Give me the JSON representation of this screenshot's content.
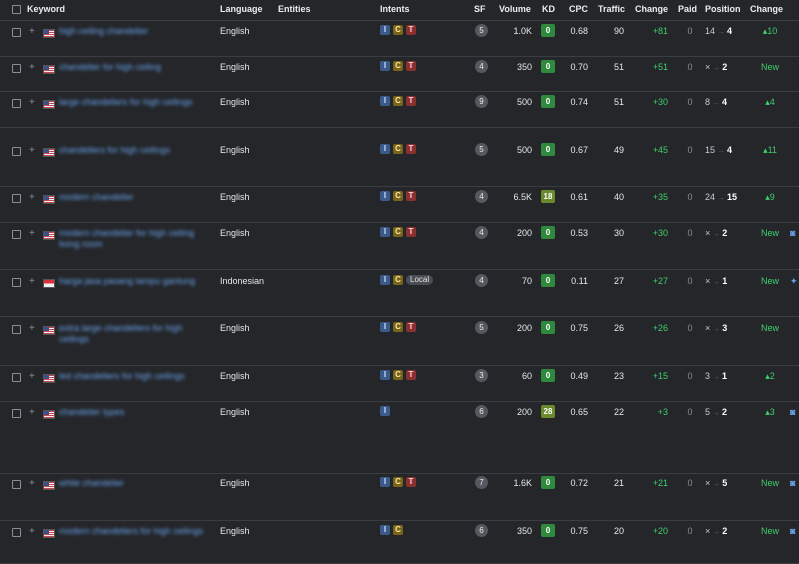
{
  "header": {
    "keyword": "Keyword",
    "language": "Language",
    "entities": "Entities",
    "intents": "Intents",
    "sf": "SF",
    "volume": "Volume",
    "kd": "KD",
    "cpc": "CPC",
    "traffic": "Traffic",
    "change": "Change",
    "paid": "Paid",
    "position": "Position",
    "position_change": "Change"
  },
  "rows": [
    {
      "keyword": "high ceiling chandelier",
      "flag": "us",
      "language": "English",
      "intents": [
        "I",
        "C",
        "T"
      ],
      "sf": "5",
      "volume": "1.0K",
      "kd": "0",
      "cpc": "0.68",
      "traffic": "90",
      "change": "+81",
      "paid": "0",
      "pos_prev": "14",
      "pos_cur": "4",
      "pos_change": "▴10",
      "edge": ""
    },
    {
      "keyword": "chandelier for high ceiling",
      "flag": "us",
      "language": "English",
      "intents": [
        "I",
        "C",
        "T"
      ],
      "sf": "4",
      "volume": "350",
      "kd": "0",
      "cpc": "0.70",
      "traffic": "51",
      "change": "+51",
      "paid": "0",
      "pos_prev": "×",
      "pos_cur": "2",
      "pos_change": "New",
      "edge": ""
    },
    {
      "keyword": "large chandeliers for high ceilings",
      "flag": "us",
      "language": "English",
      "intents": [
        "I",
        "C",
        "T"
      ],
      "sf": "9",
      "volume": "500",
      "kd": "0",
      "cpc": "0.74",
      "traffic": "51",
      "change": "+30",
      "paid": "0",
      "pos_prev": "8",
      "pos_cur": "4",
      "pos_change": "▴4",
      "edge": ""
    },
    {
      "keyword": "chandeliers for high ceilings",
      "flag": "us",
      "language": "English",
      "intents": [
        "I",
        "C",
        "T"
      ],
      "sf": "5",
      "volume": "500",
      "kd": "0",
      "cpc": "0.67",
      "traffic": "49",
      "change": "+45",
      "paid": "0",
      "pos_prev": "15",
      "pos_cur": "4",
      "pos_change": "▴11",
      "edge": ""
    },
    {
      "keyword": "modern chandelier",
      "flag": "us",
      "language": "English",
      "intents": [
        "I",
        "C",
        "T"
      ],
      "sf": "4",
      "volume": "6.5K",
      "kd": "18",
      "cpc": "0.61",
      "traffic": "40",
      "change": "+35",
      "paid": "0",
      "pos_prev": "24",
      "pos_cur": "15",
      "pos_change": "▴9",
      "edge": ""
    },
    {
      "keyword": "modern chandelier for high ceiling living room",
      "flag": "us",
      "language": "English",
      "intents": [
        "I",
        "C",
        "T"
      ],
      "sf": "4",
      "volume": "200",
      "kd": "0",
      "cpc": "0.53",
      "traffic": "30",
      "change": "+30",
      "paid": "0",
      "pos_prev": "×",
      "pos_cur": "2",
      "pos_change": "New",
      "edge": "◙"
    },
    {
      "keyword": "harga jasa pasang lampu gantung",
      "flag": "id",
      "language": "Indonesian",
      "intents": [
        "I",
        "C",
        "Local"
      ],
      "sf": "4",
      "volume": "70",
      "kd": "0",
      "cpc": "0.11",
      "traffic": "27",
      "change": "+27",
      "paid": "0",
      "pos_prev": "×",
      "pos_cur": "1",
      "pos_change": "New",
      "edge": "✦"
    },
    {
      "keyword": "extra large chandeliers for high ceilings",
      "flag": "us",
      "language": "English",
      "intents": [
        "I",
        "C",
        "T"
      ],
      "sf": "5",
      "volume": "200",
      "kd": "0",
      "cpc": "0.75",
      "traffic": "26",
      "change": "+26",
      "paid": "0",
      "pos_prev": "×",
      "pos_cur": "3",
      "pos_change": "New",
      "edge": ""
    },
    {
      "keyword": "led chandeliers for high ceilings",
      "flag": "us",
      "language": "English",
      "intents": [
        "I",
        "C",
        "T"
      ],
      "sf": "3",
      "volume": "60",
      "kd": "0",
      "cpc": "0.49",
      "traffic": "23",
      "change": "+15",
      "paid": "0",
      "pos_prev": "3",
      "pos_cur": "1",
      "pos_change": "▴2",
      "edge": ""
    },
    {
      "keyword": "chandelier types",
      "flag": "us",
      "language": "English",
      "intents": [
        "I"
      ],
      "sf": "6",
      "volume": "200",
      "kd": "28",
      "cpc": "0.65",
      "traffic": "22",
      "change": "+3",
      "paid": "0",
      "pos_prev": "5",
      "pos_cur": "2",
      "pos_change": "▴3",
      "edge": "◙"
    },
    {
      "keyword": "white chandelier",
      "flag": "us",
      "language": "English",
      "intents": [
        "I",
        "C",
        "T"
      ],
      "sf": "7",
      "volume": "1.6K",
      "kd": "0",
      "cpc": "0.72",
      "traffic": "21",
      "change": "+21",
      "paid": "0",
      "pos_prev": "×",
      "pos_cur": "5",
      "pos_change": "New",
      "edge": "◙"
    },
    {
      "keyword": "modern chandeliers for high ceilings",
      "flag": "us",
      "language": "English",
      "intents": [
        "I",
        "C"
      ],
      "sf": "6",
      "volume": "350",
      "kd": "0",
      "cpc": "0.75",
      "traffic": "20",
      "change": "+20",
      "paid": "0",
      "pos_prev": "×",
      "pos_cur": "2",
      "pos_change": "New",
      "edge": "◙"
    }
  ]
}
